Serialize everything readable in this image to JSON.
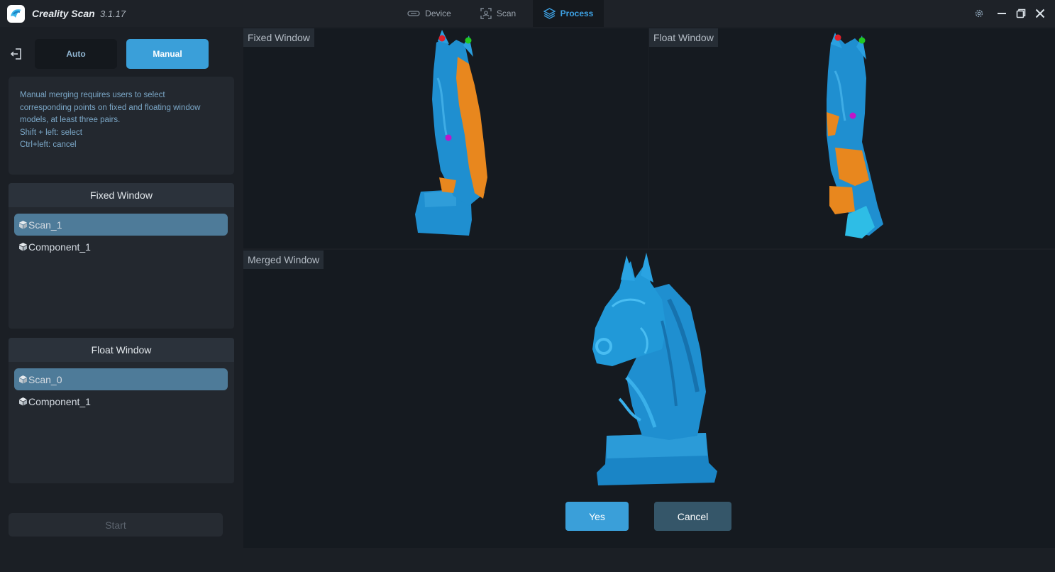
{
  "app": {
    "name": "Creality Scan",
    "version": "3.1.17"
  },
  "nav": {
    "tabs": [
      {
        "label": "Device",
        "icon": "device-icon",
        "active": false
      },
      {
        "label": "Scan",
        "icon": "scan-icon",
        "active": false
      },
      {
        "label": "Process",
        "icon": "layers-icon",
        "active": true
      }
    ]
  },
  "mode": {
    "auto_label": "Auto",
    "manual_label": "Manual",
    "selected": "Manual"
  },
  "help": {
    "lines": [
      "Manual merging requires users to select",
      "corresponding points on fixed and floating window",
      "models, at least three pairs.",
      "Shift + left: select",
      "Ctrl+left: cancel"
    ]
  },
  "fixed_list": {
    "title": "Fixed Window",
    "items": [
      {
        "label": "Scan_1",
        "selected": true
      },
      {
        "label": "Component_1",
        "selected": false
      }
    ]
  },
  "float_list": {
    "title": "Float Window",
    "items": [
      {
        "label": "Scan_0",
        "selected": true
      },
      {
        "label": "Component_1",
        "selected": false
      }
    ]
  },
  "start_label": "Start",
  "views": {
    "fixed_label": "Fixed Window",
    "float_label": "Float Window",
    "merged_label": "Merged Window"
  },
  "actions": {
    "yes_label": "Yes",
    "cancel_label": "Cancel"
  },
  "colors": {
    "accent": "#3a9fd9",
    "model_blue": "#1f8fd0",
    "model_orange": "#e8871e",
    "point_red": "#e0202a",
    "point_green": "#22c722",
    "point_magenta": "#c016c8"
  }
}
